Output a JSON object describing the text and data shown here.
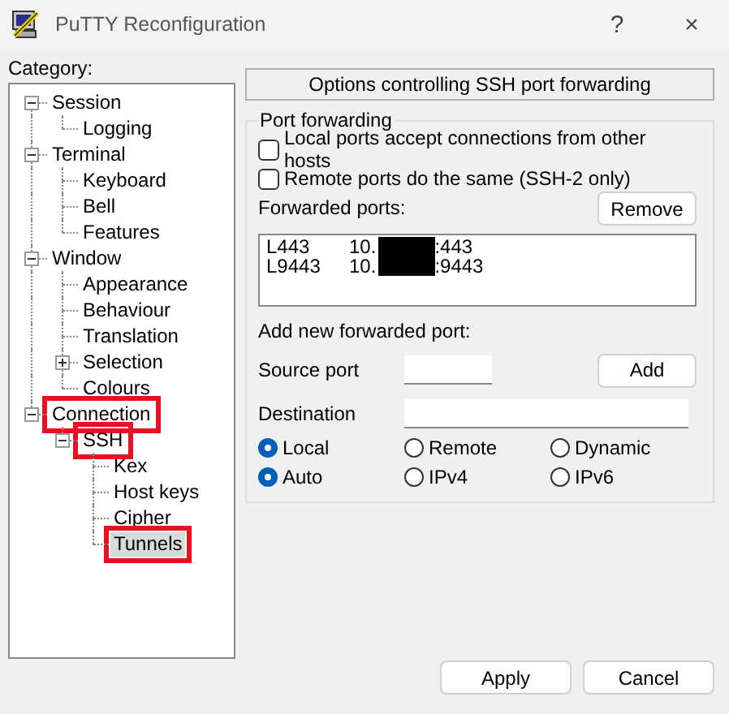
{
  "window": {
    "title": "PuTTY Reconfiguration",
    "help_button": "?",
    "close_button": "×"
  },
  "category_label": "Category:",
  "tree": [
    {
      "label": "Session",
      "expanded": true,
      "selected": false,
      "highlighted": false,
      "children": [
        {
          "label": "Logging",
          "selected": false,
          "highlighted": false
        }
      ]
    },
    {
      "label": "Terminal",
      "expanded": true,
      "selected": false,
      "highlighted": false,
      "children": [
        {
          "label": "Keyboard",
          "selected": false,
          "highlighted": false
        },
        {
          "label": "Bell",
          "selected": false,
          "highlighted": false
        },
        {
          "label": "Features",
          "selected": false,
          "highlighted": false
        }
      ]
    },
    {
      "label": "Window",
      "expanded": true,
      "selected": false,
      "highlighted": false,
      "children": [
        {
          "label": "Appearance",
          "selected": false,
          "highlighted": false
        },
        {
          "label": "Behaviour",
          "selected": false,
          "highlighted": false
        },
        {
          "label": "Translation",
          "selected": false,
          "highlighted": false
        },
        {
          "label": "Selection",
          "expanded": false,
          "selected": false,
          "highlighted": false
        },
        {
          "label": "Colours",
          "selected": false,
          "highlighted": false
        }
      ]
    },
    {
      "label": "Connection",
      "expanded": true,
      "selected": false,
      "highlighted": true,
      "children": [
        {
          "label": "SSH",
          "expanded": true,
          "selected": false,
          "highlighted": true,
          "children": [
            {
              "label": "Kex",
              "selected": false,
              "highlighted": false
            },
            {
              "label": "Host keys",
              "selected": false,
              "highlighted": false
            },
            {
              "label": "Cipher",
              "selected": false,
              "highlighted": false
            },
            {
              "label": "Tunnels",
              "selected": true,
              "highlighted": true
            }
          ]
        }
      ]
    }
  ],
  "panel": {
    "header": "Options controlling SSH port forwarding",
    "group_title": "Port forwarding",
    "checkboxes": [
      {
        "label": "Local ports accept connections from other hosts",
        "checked": false
      },
      {
        "label": "Remote ports do the same (SSH-2 only)",
        "checked": false
      }
    ],
    "forwarded_ports_label": "Forwarded ports:",
    "remove_button": "Remove",
    "forwarded_ports": [
      {
        "source": "L443",
        "dest_start": "10.",
        "dest_end": ":443",
        "redacted": true
      },
      {
        "source": "L9443",
        "dest_start": "10.",
        "dest_end": ":9443",
        "redacted": true
      }
    ],
    "add_label": "Add new forwarded port:",
    "source_port_label": "Source port",
    "add_button": "Add",
    "destination_label": "Destination",
    "radio_rows": [
      [
        {
          "label": "Local",
          "selected": true
        },
        {
          "label": "Remote",
          "selected": false
        },
        {
          "label": "Dynamic",
          "selected": false
        }
      ],
      [
        {
          "label": "Auto",
          "selected": true
        },
        {
          "label": "IPv4",
          "selected": false
        },
        {
          "label": "IPv6",
          "selected": false
        }
      ]
    ]
  },
  "buttons": [
    "Apply",
    "Cancel"
  ]
}
